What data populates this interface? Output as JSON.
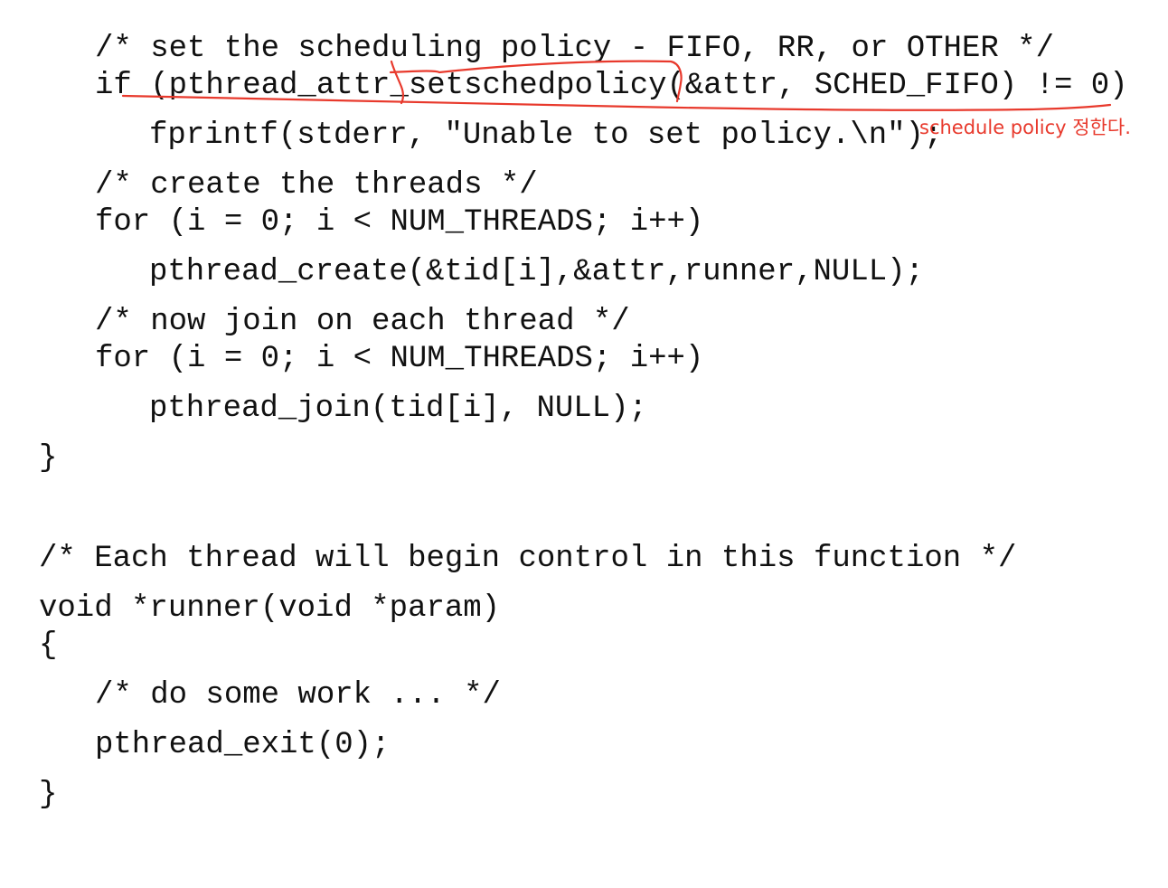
{
  "code_lines": [
    "/* set the scheduling policy - FIFO, RR, or OTHER */",
    "if (pthread_attr_setschedpolicy(&attr, SCHED_FIFO) != 0)",
    "fprintf(stderr, \"Unable to set policy.\\n\");",
    "/* create the threads */",
    "for (i = 0; i < NUM_THREADS; i++)",
    "pthread_create(&tid[i],&attr,runner,NULL);",
    "/* now join on each thread */",
    "for (i = 0; i < NUM_THREADS; i++)",
    "pthread_join(tid[i], NULL);",
    "}",
    "/* Each thread will begin control in this function */",
    "void *runner(void *param)",
    "{",
    "/* do some work ... */",
    "pthread_exit(0);",
    "}"
  ],
  "annotation": {
    "text": "schedule policy 정한다.",
    "color": "#e8392c"
  }
}
